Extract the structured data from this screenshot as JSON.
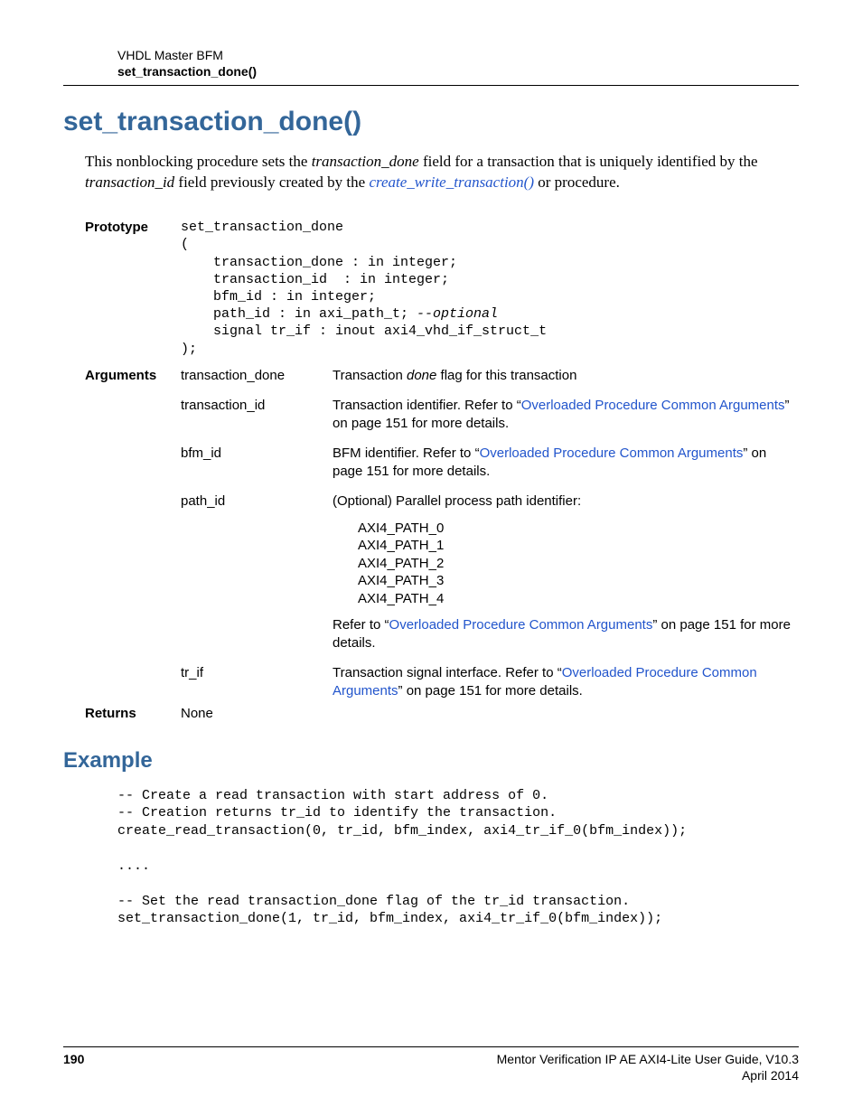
{
  "header": {
    "line1": "VHDL Master BFM",
    "line2": "set_transaction_done()"
  },
  "title": "set_transaction_done()",
  "intro": {
    "part1": "This nonblocking procedure sets the ",
    "field1": "transaction_done",
    "part2": " field for a transaction that is uniquely identified by the ",
    "field2": "transaction_id",
    "part3": " field previously created by the ",
    "link": "create_write_transaction()",
    "part4": " or procedure."
  },
  "labels": {
    "prototype": "Prototype",
    "arguments": "Arguments",
    "returns": "Returns"
  },
  "prototype": {
    "l1": "set_transaction_done",
    "l2": "(",
    "l3": "    transaction_done : in integer;",
    "l4": "    transaction_id  : in integer;",
    "l5": "    bfm_id : in integer;",
    "l6a": "    path_id : in axi_path_t; ",
    "l6b": "--optional",
    "l7": "    signal tr_if : inout axi4_vhd_if_struct_t",
    "l8": ");"
  },
  "args": {
    "td": {
      "name": "transaction_done",
      "d1": "Transaction ",
      "d_em": "done",
      "d2": " flag for this transaction"
    },
    "tid": {
      "name": "transaction_id",
      "d1": "Transaction identifier. Refer to ",
      "q": "“",
      "link": "Overloaded Procedure Common Arguments",
      "d2": "” on page 151 for more details."
    },
    "bfm": {
      "name": "bfm_id",
      "d1": "BFM identifier. Refer to ",
      "q": "“",
      "link": "Overloaded Procedure Common Arguments",
      "d2": "” on page 151 for more details."
    },
    "path": {
      "name": "path_id",
      "d1": "(Optional) Parallel process path identifier:",
      "p0": "AXI4_PATH_0",
      "p1": "AXI4_PATH_1",
      "p2": "AXI4_PATH_2",
      "p3": "AXI4_PATH_3",
      "p4": "AXI4_PATH_4",
      "r1": "Refer to ",
      "q": "“",
      "link": "Overloaded Procedure Common Arguments",
      "r2": "” on page 151 for more details."
    },
    "trif": {
      "name": "tr_if",
      "d1": "Transaction signal interface. Refer to ",
      "q": "“",
      "link": "Overloaded Procedure Common Arguments",
      "d2": "” on page 151 for more details."
    }
  },
  "returns": {
    "value": "None"
  },
  "example_heading": "Example",
  "example_code": "-- Create a read transaction with start address of 0.\n-- Creation returns tr_id to identify the transaction.\ncreate_read_transaction(0, tr_id, bfm_index, axi4_tr_if_0(bfm_index));\n\n....\n\n-- Set the read transaction_done flag of the tr_id transaction.\nset_transaction_done(1, tr_id, bfm_index, axi4_tr_if_0(bfm_index));",
  "footer": {
    "page": "190",
    "doc": "Mentor Verification IP AE AXI4-Lite User Guide, V10.3",
    "date": "April 2014"
  }
}
